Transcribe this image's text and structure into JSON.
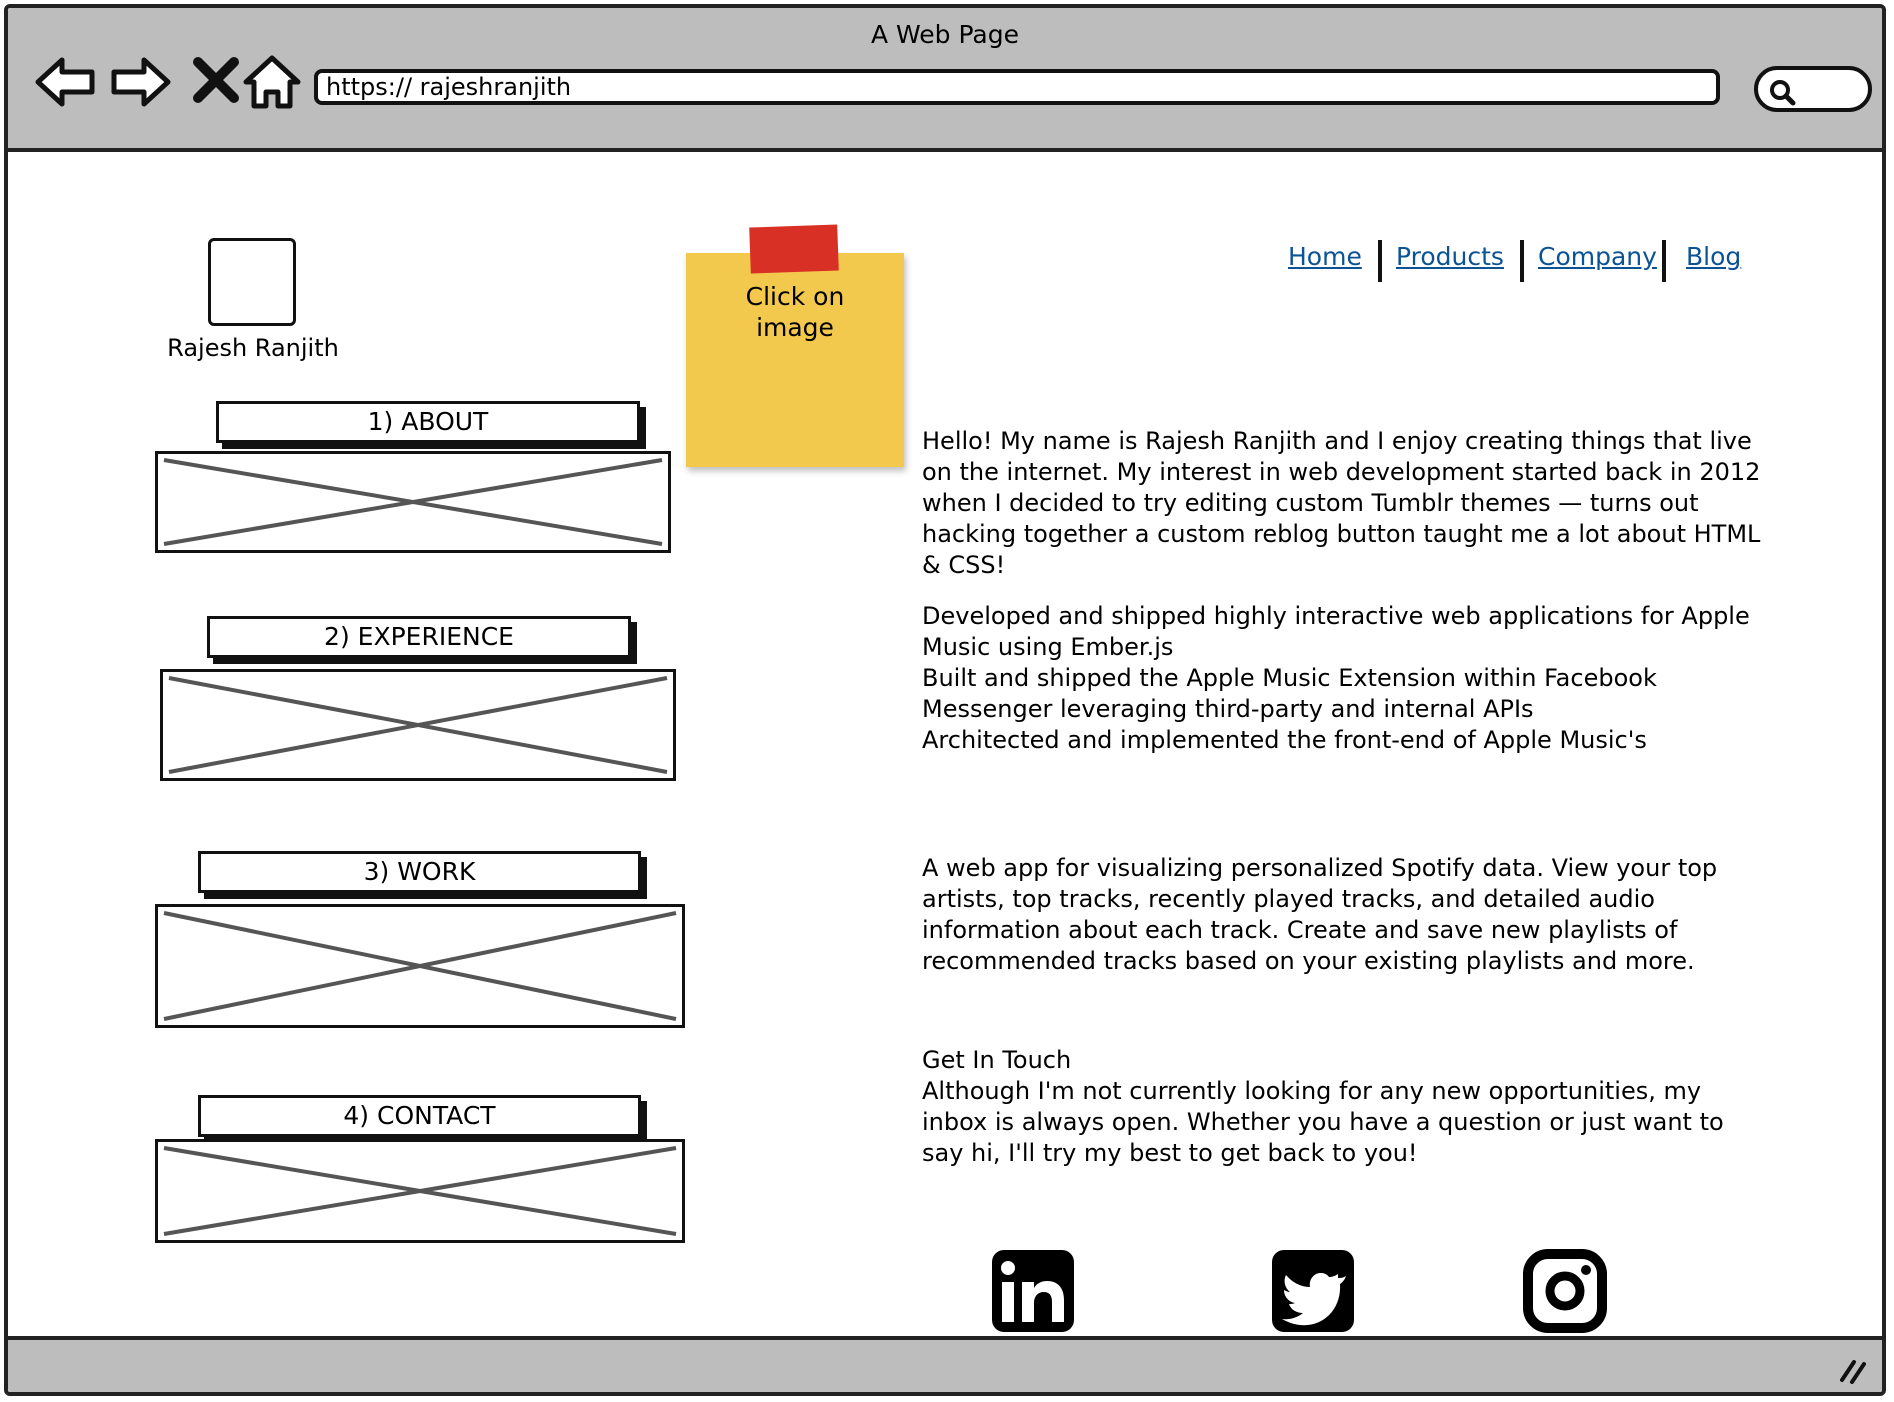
{
  "window": {
    "title": "A Web Page"
  },
  "browser": {
    "url": "https://  rajeshranjith"
  },
  "profile": {
    "name": "Rajesh Ranjith"
  },
  "sticky_note": {
    "line1": "Click on",
    "line2": "image"
  },
  "nav": {
    "home": "Home",
    "products": "Products",
    "company": "Company",
    "blog": "Blog"
  },
  "sections": {
    "about": "1) ABOUT",
    "experience": "2) EXPERIENCE",
    "work": "3) WORK",
    "contact": "4) CONTACT"
  },
  "about": {
    "text": "Hello! My name is Rajesh Ranjith and I enjoy creating things that live on the internet. My interest in web development started back in 2012 when I decided to try editing custom Tumblr themes — turns out hacking together a custom reblog button taught me a lot about HTML & CSS!"
  },
  "experience": {
    "items": [
      "Developed and shipped highly interactive web applications for Apple Music using Ember.js",
      "Built and shipped the Apple Music Extension within Facebook Messenger leveraging third-party and internal APIs",
      "Architected and implemented the front-end of Apple Music's"
    ]
  },
  "work": {
    "text": "A web app for visualizing personalized Spotify data. View your top artists, top tracks, recently played tracks, and detailed audio information about each track. Create and save new playlists of recommended tracks based on your existing playlists and more."
  },
  "contact": {
    "heading": "Get In Touch",
    "text": "Although I'm not currently looking for any new opportunities, my inbox is always open. Whether you have a question or just want to say hi, I'll try my best to get back to you!"
  },
  "social": [
    "linkedin-icon",
    "twitter-icon",
    "instagram-icon"
  ]
}
